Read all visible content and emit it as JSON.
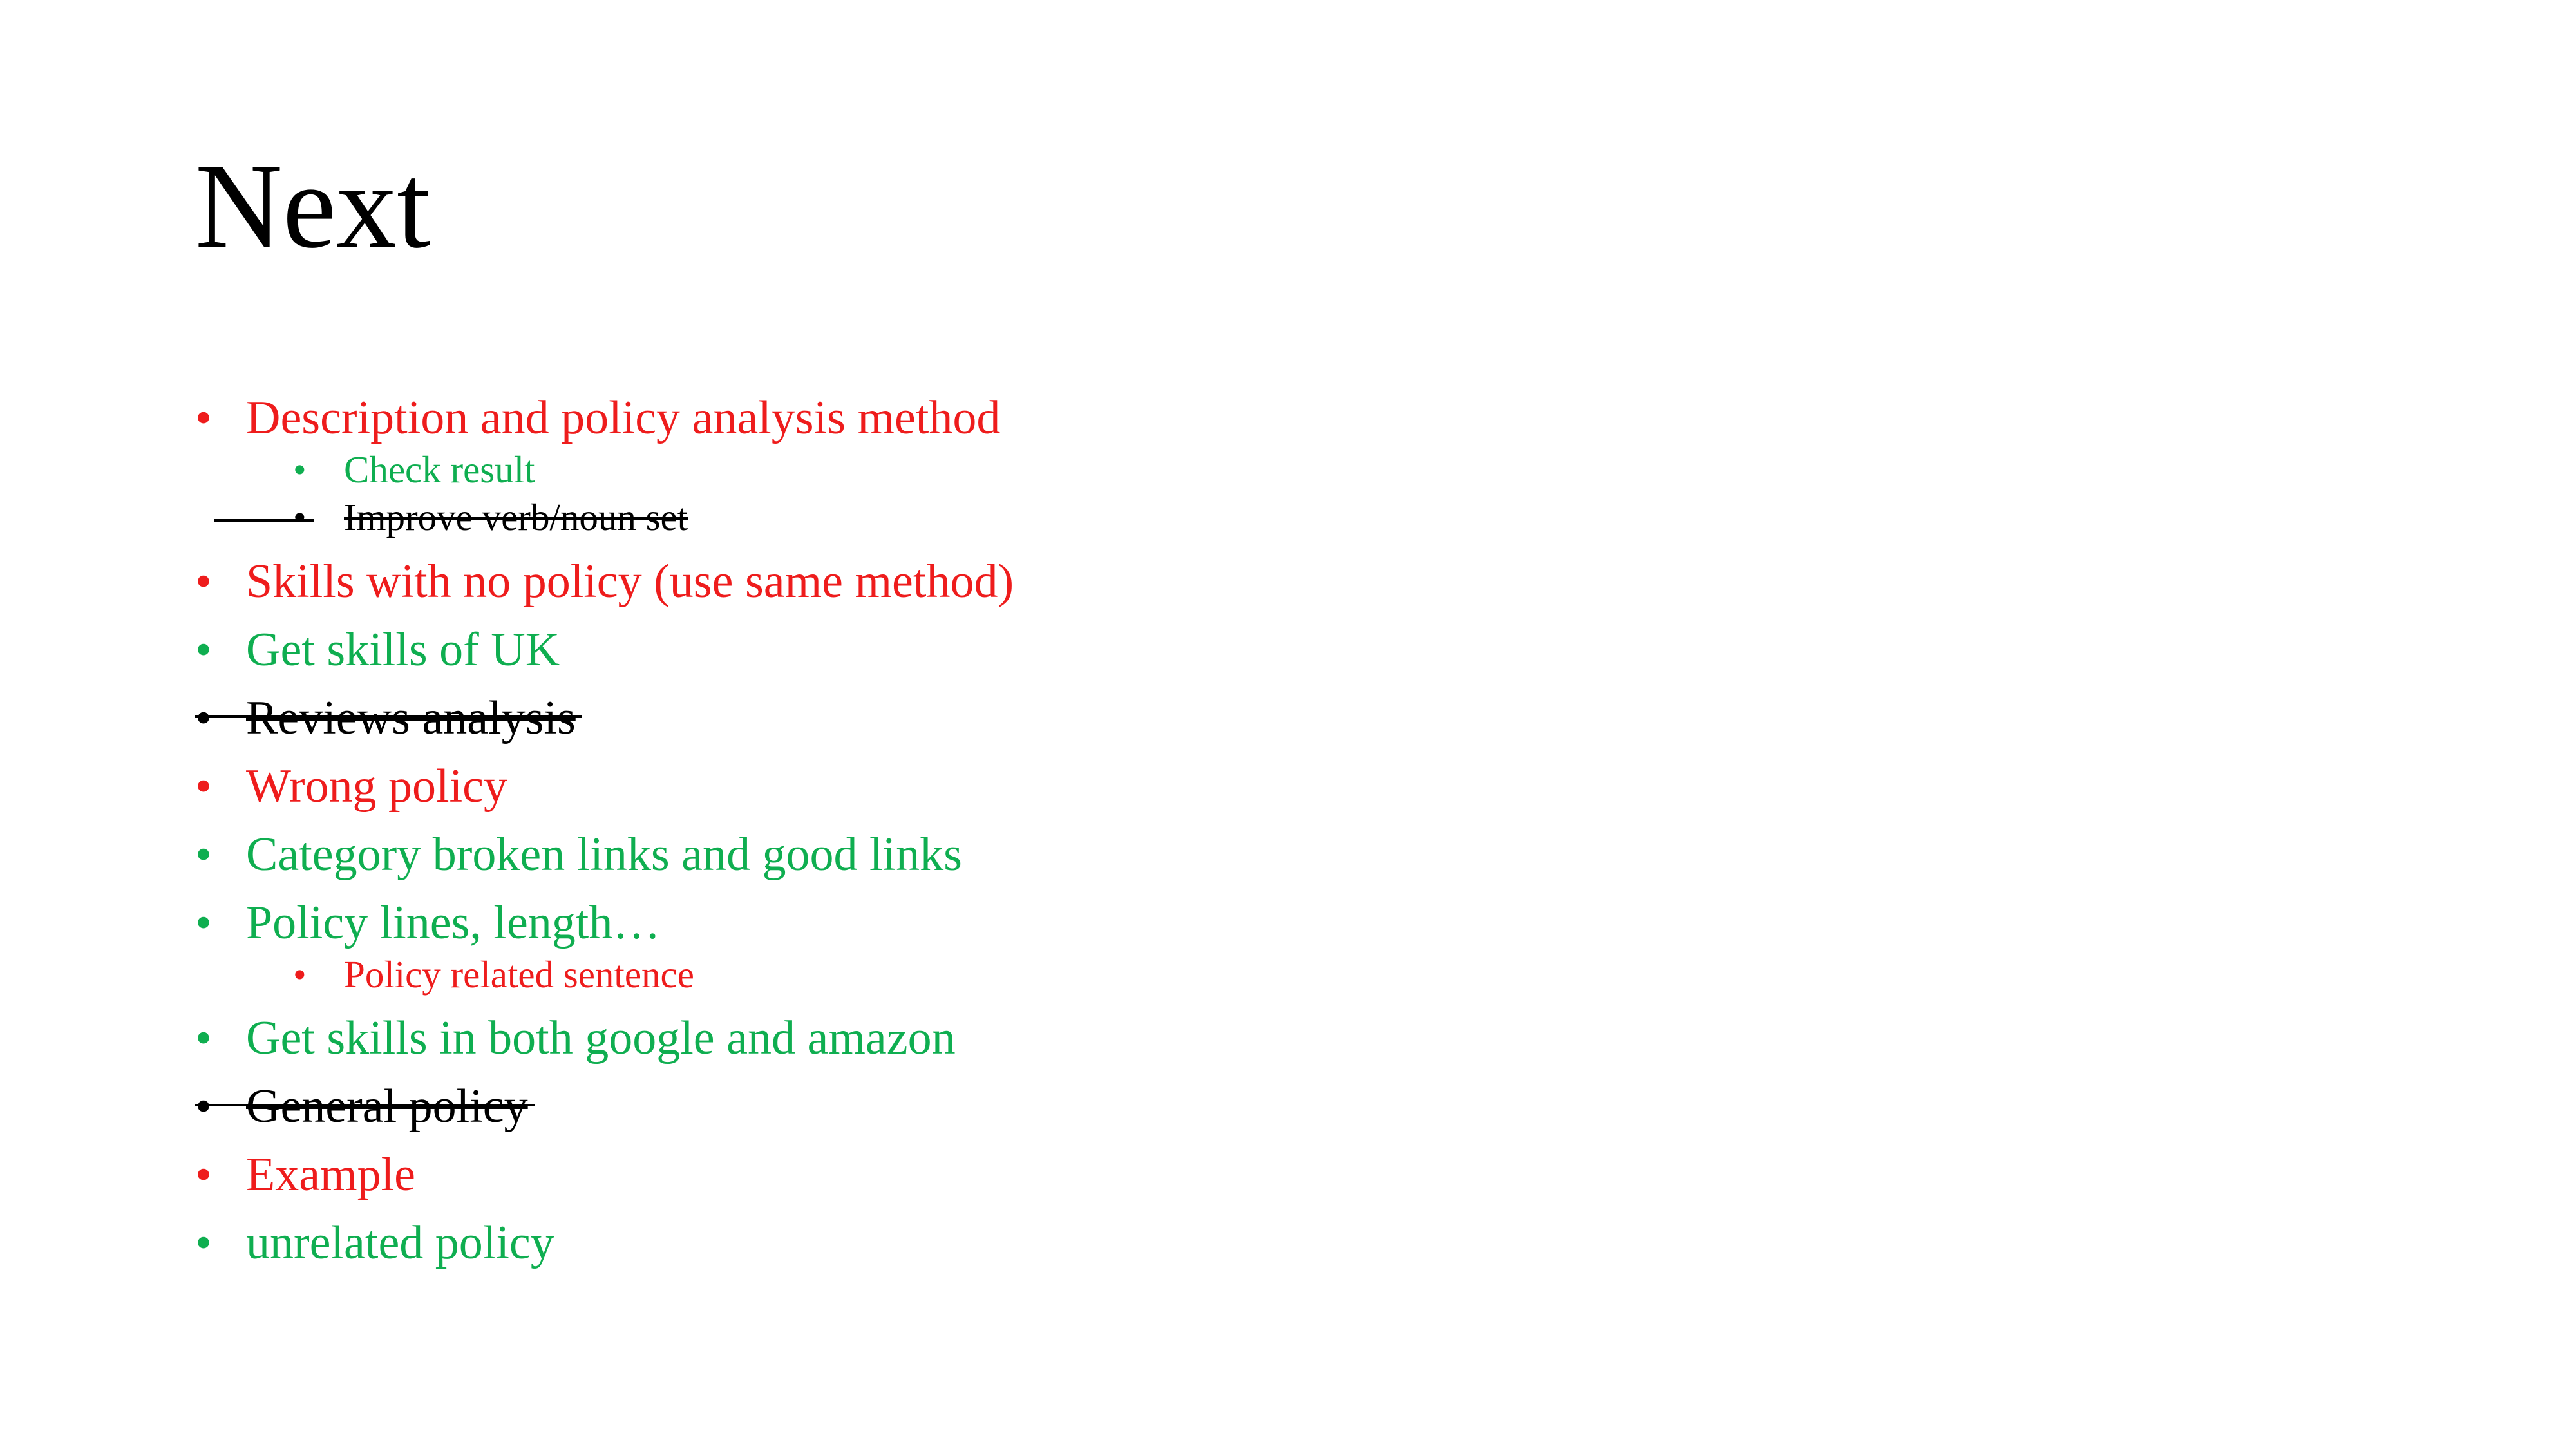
{
  "slide": {
    "title": "Next",
    "bullet_glyph": "•",
    "colors": {
      "red": "#ee1c1c",
      "green": "#0fae50",
      "struck": "#000000"
    },
    "items": [
      {
        "label": "Description and policy analysis method",
        "level": 1,
        "color": "red",
        "struck": false
      },
      {
        "label": "Check result",
        "level": 2,
        "color": "green",
        "struck": false
      },
      {
        "label": "Improve verb/noun set",
        "level": 2,
        "color": "black",
        "struck": true
      },
      {
        "label": "Skills with no policy (use same method)",
        "level": 1,
        "color": "red",
        "struck": false
      },
      {
        "label": "Get skills of UK",
        "level": 1,
        "color": "green",
        "struck": false
      },
      {
        "label": "Reviews analysis",
        "level": 1,
        "color": "black",
        "struck": true
      },
      {
        "label": "Wrong policy",
        "level": 1,
        "color": "red",
        "struck": false
      },
      {
        "label": "Category broken links and good links",
        "level": 1,
        "color": "green",
        "struck": false
      },
      {
        "label": "Policy lines, length…",
        "level": 1,
        "color": "green",
        "struck": false
      },
      {
        "label": "Policy related sentence",
        "level": 2,
        "color": "red",
        "struck": false
      },
      {
        "label": "Get skills in both google and amazon",
        "level": 1,
        "color": "green",
        "struck": false
      },
      {
        "label": "General policy",
        "level": 1,
        "color": "black",
        "struck": true
      },
      {
        "label": "Example",
        "level": 1,
        "color": "red",
        "struck": false
      },
      {
        "label": "unrelated policy",
        "level": 1,
        "color": "green",
        "struck": false
      }
    ]
  }
}
